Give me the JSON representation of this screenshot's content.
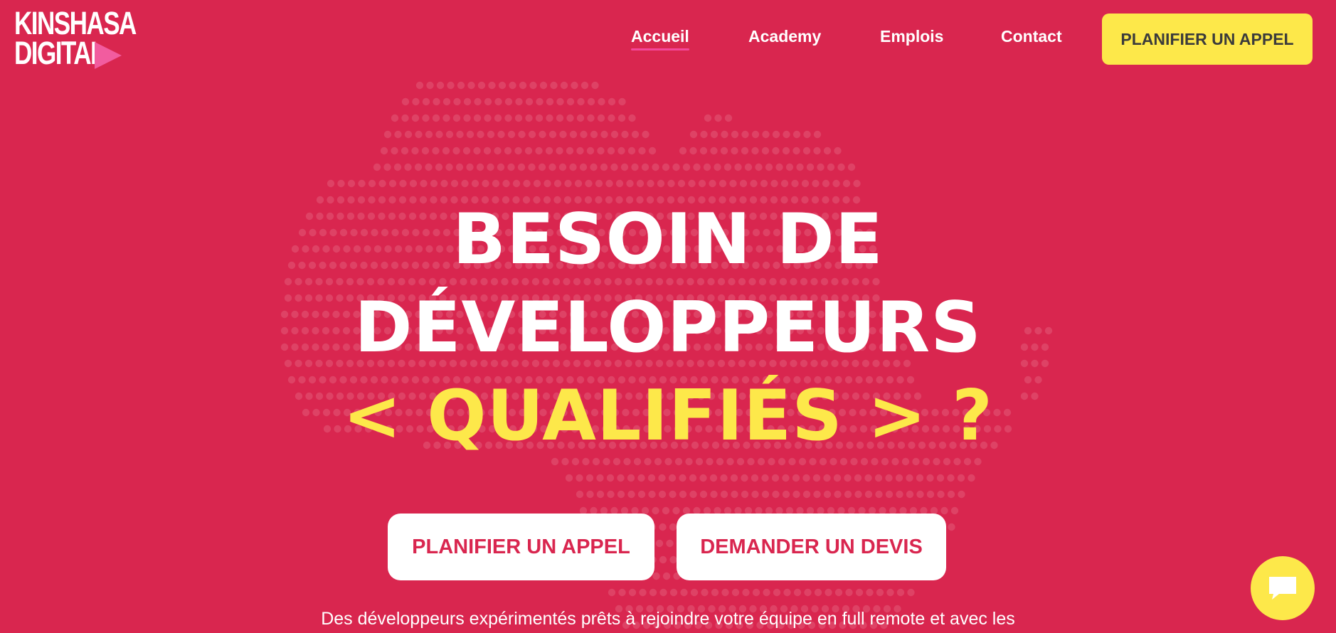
{
  "brand": {
    "logo_line1": "KINSHASA",
    "logo_line2": "DIGITAL",
    "logo_icon": "play-icon"
  },
  "nav": {
    "items": [
      {
        "label": "Accueil",
        "active": true
      },
      {
        "label": "Academy",
        "active": false
      },
      {
        "label": "Emplois",
        "active": false
      },
      {
        "label": "Contact",
        "active": false
      }
    ],
    "cta_label": "PLANIFIER UN APPEL"
  },
  "hero": {
    "line1": "BESOIN DE",
    "line2": "DÉVELOPPEURS",
    "line3": "< QUALIFIÉS > ?",
    "button_call": "PLANIFIER UN APPEL",
    "button_quote": "DEMANDER UN DEVIS",
    "description": "Des développeurs expérimentés prêts à rejoindre votre équipe en full remote et avec les"
  },
  "chat": {
    "icon": "chat-bubble-icon"
  },
  "colors": {
    "background": "#d9264f",
    "accent_yellow": "#fde84a",
    "accent_pink": "#f25c9f",
    "text_dark": "#3b3b3b"
  }
}
